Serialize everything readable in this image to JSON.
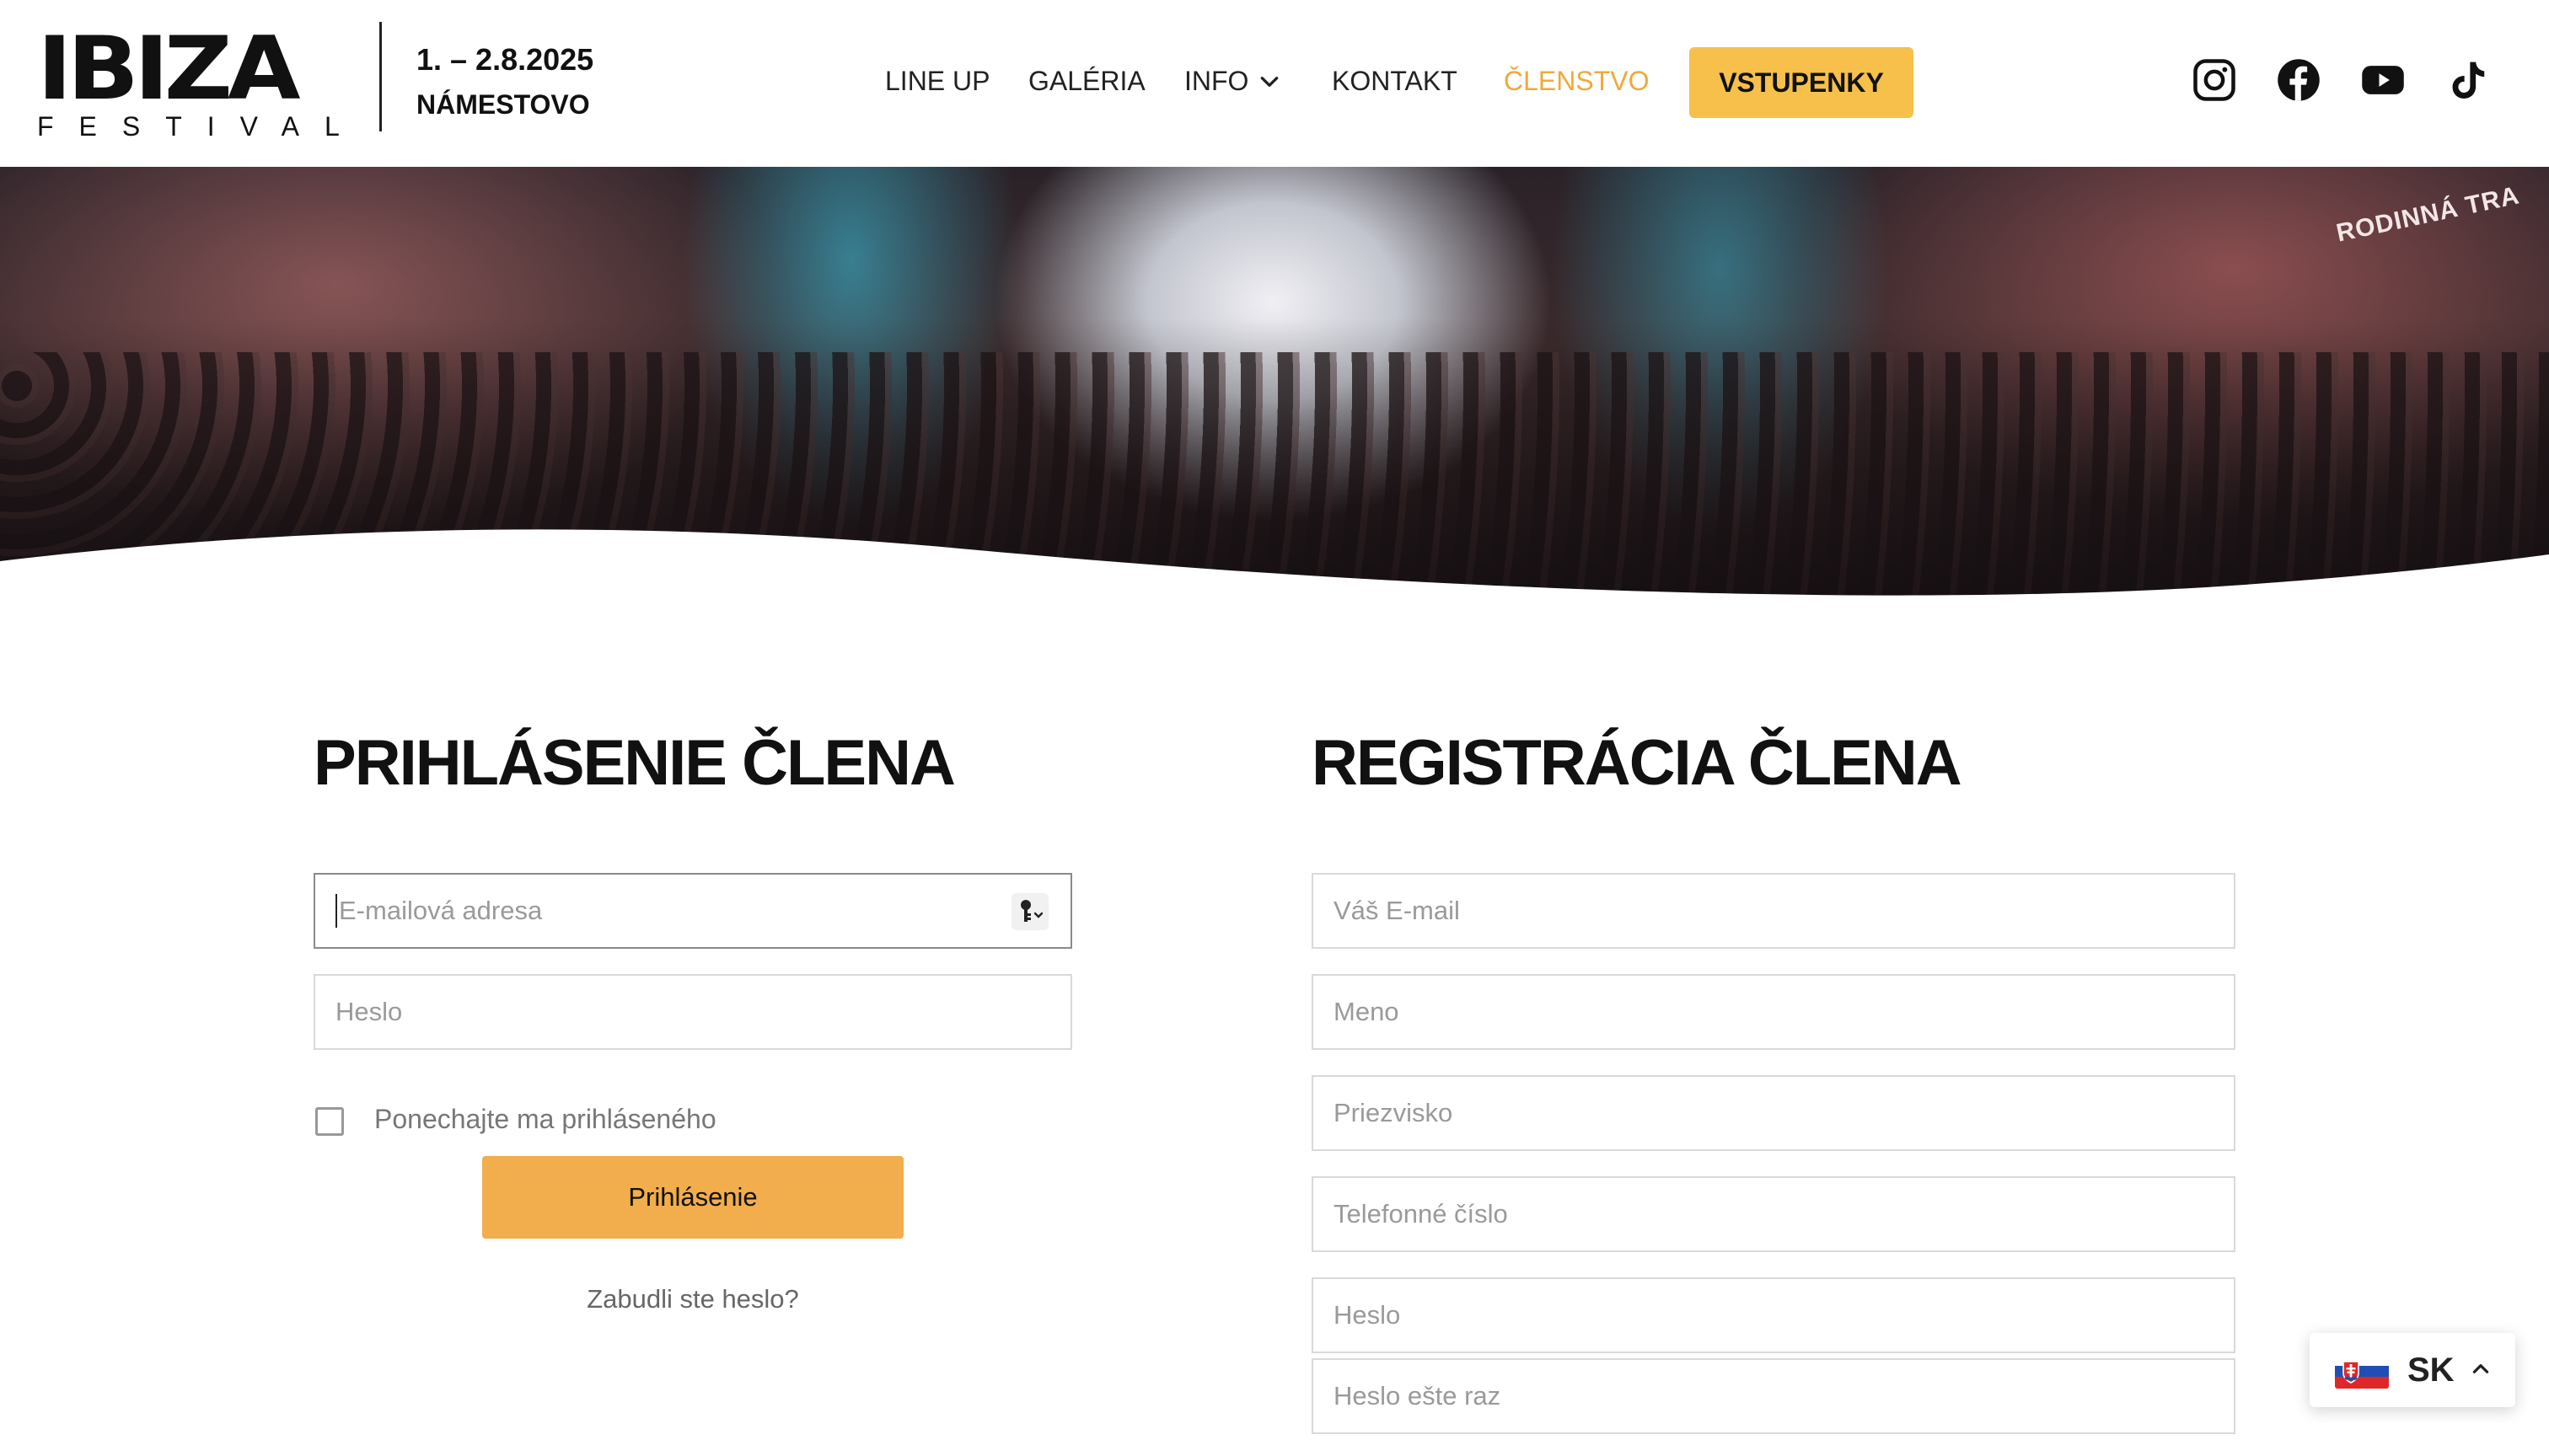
{
  "header": {
    "logo": {
      "main": "IBIZA",
      "sub": "FESTIVAL"
    },
    "event_date": "1. – 2.8.2025",
    "event_place": "NÁMESTOVO",
    "nav": [
      {
        "label": "LINE UP"
      },
      {
        "label": "GALÉRIA"
      },
      {
        "label": "INFO"
      },
      {
        "label": "KONTAKT"
      },
      {
        "label": "ČLENSTVO",
        "active": true
      }
    ],
    "ticket_button": "VSTUPENKY",
    "social": [
      "instagram-icon",
      "facebook-icon",
      "youtube-icon",
      "tiktok-icon"
    ]
  },
  "hero": {
    "banner_text": "RODINNÁ TRA"
  },
  "login": {
    "title": "PRIHLÁSENIE ČLENA",
    "email_placeholder": "E-mailová adresa",
    "password_placeholder": "Heslo",
    "remember_label": "Ponechajte ma prihláseného",
    "submit_label": "Prihlásenie",
    "forgot_label": "Zabudli ste heslo?"
  },
  "register": {
    "title": "REGISTRÁCIA ČLENA",
    "fields": [
      {
        "placeholder": "Váš E-mail"
      },
      {
        "placeholder": "Meno"
      },
      {
        "placeholder": "Priezvisko"
      },
      {
        "placeholder": "Telefonné číslo"
      },
      {
        "placeholder": "Heslo"
      },
      {
        "placeholder": "Heslo ešte raz"
      }
    ]
  },
  "language": {
    "code": "SK",
    "flag": "slovakia-flag"
  },
  "colors": {
    "accent": "#f0a93a",
    "ticket_button": "#f6c04a",
    "login_button": "#f2ad4c",
    "text": "#111111"
  }
}
